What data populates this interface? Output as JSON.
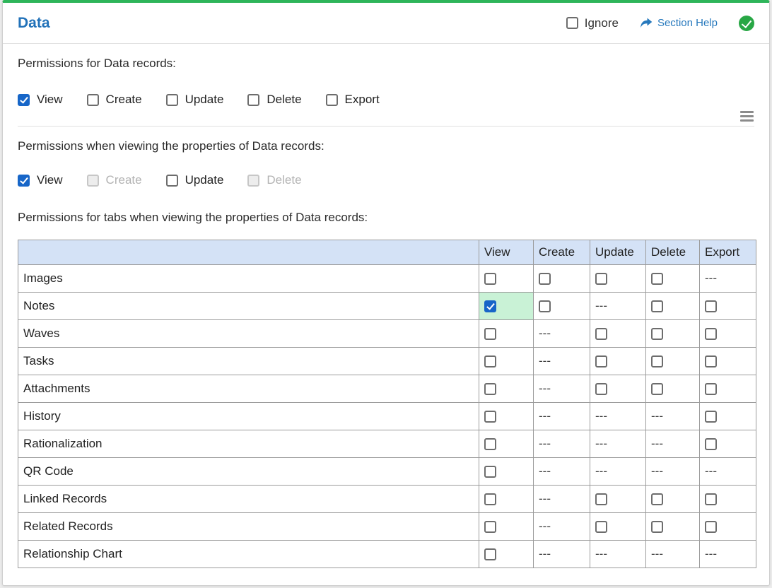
{
  "colors": {
    "accent_green": "#2eb55a",
    "title_blue": "#2272b9",
    "link_blue": "#2779bd",
    "success_green": "#28a745",
    "checkbox_checked": "#1766c8",
    "header_row_bg": "#d4e2f6",
    "highlight_green": "#c9f2d6",
    "table_border": "#9b9b9b"
  },
  "icons": {
    "section_help": "forward-arrow-icon",
    "status": "check-circle-icon",
    "menu": "hamburger-menu-icon"
  },
  "header": {
    "title": "Data",
    "ignore_label": "Ignore",
    "ignore_checked": false,
    "section_help_label": "Section Help"
  },
  "sections": {
    "records": {
      "label": "Permissions for Data records:",
      "checkboxes": [
        {
          "label": "View",
          "checked": true,
          "disabled": false
        },
        {
          "label": "Create",
          "checked": false,
          "disabled": false
        },
        {
          "label": "Update",
          "checked": false,
          "disabled": false
        },
        {
          "label": "Delete",
          "checked": false,
          "disabled": false
        },
        {
          "label": "Export",
          "checked": false,
          "disabled": false
        }
      ]
    },
    "properties": {
      "label": "Permissions when viewing the properties of Data records:",
      "checkboxes": [
        {
          "label": "View",
          "checked": true,
          "disabled": false
        },
        {
          "label": "Create",
          "checked": false,
          "disabled": true
        },
        {
          "label": "Update",
          "checked": false,
          "disabled": false
        },
        {
          "label": "Delete",
          "checked": false,
          "disabled": true
        }
      ]
    },
    "tabs": {
      "label": "Permissions for tabs when viewing the properties of Data records:",
      "table": {
        "headers": [
          "",
          "View",
          "Create",
          "Update",
          "Delete",
          "Export"
        ],
        "na_text": "---",
        "rows": [
          {
            "name": "Images",
            "cells": [
              "unchecked",
              "unchecked",
              "unchecked",
              "unchecked",
              "na"
            ]
          },
          {
            "name": "Notes",
            "cells": [
              "checked",
              "unchecked",
              "na",
              "unchecked",
              "unchecked"
            ]
          },
          {
            "name": "Waves",
            "cells": [
              "unchecked",
              "na",
              "unchecked",
              "unchecked",
              "unchecked"
            ]
          },
          {
            "name": "Tasks",
            "cells": [
              "unchecked",
              "na",
              "unchecked",
              "unchecked",
              "unchecked"
            ]
          },
          {
            "name": "Attachments",
            "cells": [
              "unchecked",
              "na",
              "unchecked",
              "unchecked",
              "unchecked"
            ]
          },
          {
            "name": "History",
            "cells": [
              "unchecked",
              "na",
              "na",
              "na",
              "unchecked"
            ]
          },
          {
            "name": "Rationalization",
            "cells": [
              "unchecked",
              "na",
              "na",
              "na",
              "unchecked"
            ]
          },
          {
            "name": "QR Code",
            "cells": [
              "unchecked",
              "na",
              "na",
              "na",
              "na"
            ]
          },
          {
            "name": "Linked Records",
            "cells": [
              "unchecked",
              "na",
              "unchecked",
              "unchecked",
              "unchecked"
            ]
          },
          {
            "name": "Related Records",
            "cells": [
              "unchecked",
              "na",
              "unchecked",
              "unchecked",
              "unchecked"
            ]
          },
          {
            "name": "Relationship Chart",
            "cells": [
              "unchecked",
              "na",
              "na",
              "na",
              "na"
            ]
          }
        ]
      }
    }
  }
}
